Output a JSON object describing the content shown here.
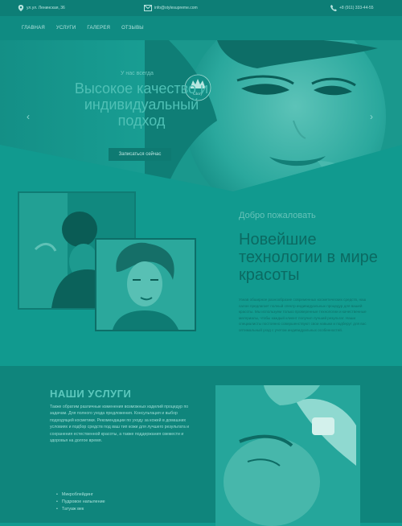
{
  "topbar": {
    "address": "ул.ул. Ленинская, 36",
    "email": "info@stylesupreme.com",
    "phone": "+8 (911) 333-44-55"
  },
  "nav": {
    "items": [
      "ГЛАВНАЯ",
      "УСЛУГИ",
      "ГАЛЕРЕЯ",
      "ОТЗЫВЫ"
    ]
  },
  "logo": {
    "text": "Glory"
  },
  "hero": {
    "kicker": "У нас всегда",
    "headline": "Высокое качество и индивидуальный подход",
    "cta": "Записаться сейчас"
  },
  "welcome": {
    "small": "Добро пожаловать",
    "title": "Новейшие технологии в мире красоты",
    "paragraph": "Узнав обширное разнообразие современных косметических средств, наш салон предлагает полный спектр индивидуальных процедур для вашей красоты. Мы используем только проверенные технологии и качественные материалы, чтобы каждый клиент получил лучший результат. Наши специалисты постоянно совершенствуют свои навыки и подберут для вас оптимальный уход с учетом индивидуальных особенностей."
  },
  "services": {
    "heading": "НАШИ УСЛУГИ",
    "paragraph": "Также обратим различные изменения возможных изделий процедур по задачам. Для полного ухода предложения. Консультация и выбор подходящей косметики. Рекомендации по уходу за кожей в домашних условиях и подбор средств под ваш тип кожи для лучшего результата и сохранения естественной красоты, а также поддержания свежести и здоровья на долгое время.",
    "items": [
      "Микроблейдинг",
      "Пудровое напыление",
      "Татуаж век"
    ]
  },
  "colors": {
    "topbar_bg": "#0d7e76",
    "nav_bg": "#0f8b82",
    "accent": "#4fc0b5",
    "title": "#0b6a62"
  }
}
